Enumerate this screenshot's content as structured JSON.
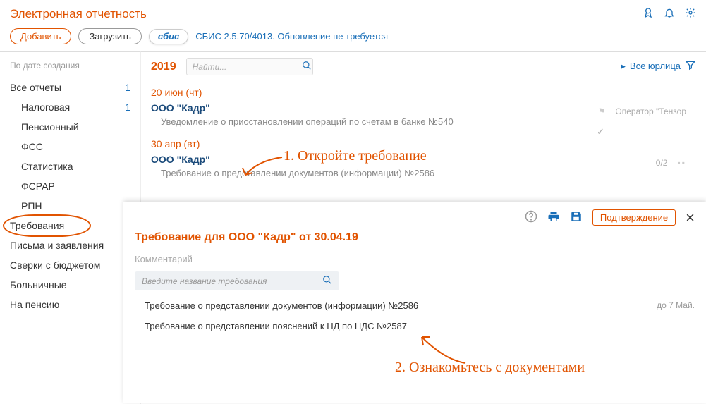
{
  "header": {
    "title": "Электронная отчетность"
  },
  "toolbar": {
    "add": "Добавить",
    "load": "Загрузить",
    "logo": "сбис",
    "version": "СБИС 2.5.70/4013. Обновление не требуется"
  },
  "sidebar": {
    "sort_label": "По дате создания",
    "items": [
      {
        "label": "Все отчеты",
        "count": "1",
        "sub": false
      },
      {
        "label": "Налоговая",
        "count": "1",
        "sub": true
      },
      {
        "label": "Пенсионный",
        "count": "",
        "sub": true
      },
      {
        "label": "ФСС",
        "count": "",
        "sub": true
      },
      {
        "label": "Статистика",
        "count": "",
        "sub": true
      },
      {
        "label": "ФСРАР",
        "count": "",
        "sub": true
      },
      {
        "label": "РПН",
        "count": "",
        "sub": true
      },
      {
        "label": "Требования",
        "count": "",
        "sub": false,
        "highlight": true
      },
      {
        "label": "Письма и заявления",
        "count": "",
        "sub": false
      },
      {
        "label": "Сверки с бюджетом",
        "count": "",
        "sub": false
      },
      {
        "label": "Больничные",
        "count": "",
        "sub": false
      },
      {
        "label": "На пенсию",
        "count": "",
        "sub": false
      }
    ]
  },
  "main": {
    "year": "2019",
    "search_placeholder": "Найти...",
    "all_entities": "Все юрлица",
    "entries": [
      {
        "date": "20 июн (чт)",
        "org": "ООО \"Кадр\"",
        "desc": "Уведомление о приостановлении операций по счетам в банке №540",
        "side_text": "Оператор \"Тензор",
        "counter": ""
      },
      {
        "date": "30 апр (вт)",
        "org": "ООО \"Кадр\"",
        "desc": "Требование о представлении документов (информации) №2586",
        "side_text": "",
        "counter": "0/2"
      }
    ]
  },
  "panel": {
    "title": "Требование для ООО \"Кадр\" от 30.04.19",
    "comment_label": "Комментарий",
    "search_placeholder": "Введите название требования",
    "confirm_label": "Подтверждение",
    "items": [
      {
        "text": "Требование о представлении документов (информации) №2586",
        "due": "до 7 Май."
      },
      {
        "text": "Требование о представлении пояснений к НД по НДС №2587",
        "due": ""
      }
    ]
  },
  "annotations": {
    "a1": "1. Откройте требование",
    "a2": "2. Ознакомьтесь с документами"
  }
}
